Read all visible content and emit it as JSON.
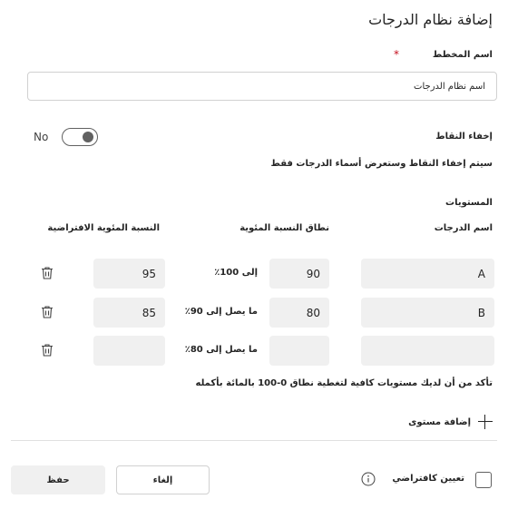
{
  "dialog": {
    "title": "إضافة نظام الدرجات",
    "scheme_name_label": "اسم المخطط",
    "required_marker": "*",
    "scheme_name_value": "اسم نظام الدرجات",
    "hide_points_label": "إخفاء النقاط",
    "toggle_state_text": "No",
    "hide_points_hint": "سيتم إخفاء النقاط وستعرض أسماء الدرجات فقط",
    "levels_label": "المستويات",
    "columns": {
      "grade_name": "اسم الدرجات",
      "percent_range": "نطاق النسبة المئوية",
      "default_percent": "النسبة المئوية الافتراضية"
    },
    "levels": [
      {
        "grade": "A",
        "min": "90",
        "range_text": "إلى 100٪",
        "default": "95"
      },
      {
        "grade": "B",
        "min": "80",
        "range_text": "ما يصل إلى 90٪",
        "default": "85"
      },
      {
        "grade": "",
        "min": "",
        "range_text": "ما يصل إلى 80٪",
        "default": ""
      }
    ],
    "coverage_note": "تأكد من أن لديك مستويات كافية لتغطية نطاق 0-100 بالمائة بأكمله",
    "add_level_label": "إضافة مستوى",
    "set_default_label": "تعيين كافتراضي",
    "cancel_label": "إلغاء",
    "save_label": "حفظ"
  }
}
